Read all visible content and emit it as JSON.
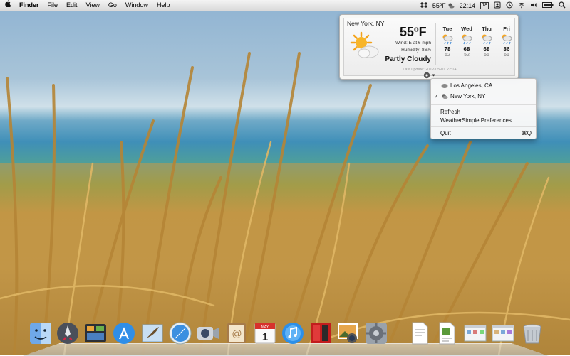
{
  "menubar": {
    "apple_icon": "apple-logo-icon",
    "app_name": "Finder",
    "menus": [
      "File",
      "Edit",
      "View",
      "Go",
      "Window",
      "Help"
    ],
    "weather_temp": "55ºF",
    "clock": "22:14",
    "calendar_day": "18"
  },
  "weather": {
    "city": "New York, NY",
    "temp": "55ºF",
    "wind": "Wind: E at 6 mph",
    "humidity": "Humidity: 86%",
    "condition": "Partly Cloudy",
    "last_update": "Last update: 2012-05-01  22:14",
    "forecast": [
      {
        "day": "Tue",
        "high": "78",
        "low": "52"
      },
      {
        "day": "Wed",
        "high": "68",
        "low": "52"
      },
      {
        "day": "Thu",
        "high": "68",
        "low": "55"
      },
      {
        "day": "Fri",
        "high": "86",
        "low": "61"
      }
    ]
  },
  "menu": {
    "locations": [
      {
        "label": "Los Angeles, CA",
        "checked": false
      },
      {
        "label": "New York, NY",
        "checked": true
      }
    ],
    "check_mark": "✓",
    "refresh": "Refresh",
    "preferences": "WeatherSimple Preferences...",
    "quit": "Quit",
    "quit_shortcut": "⌘Q"
  },
  "dock": {
    "items": [
      "finder-icon",
      "launchpad-icon",
      "mission-control-icon",
      "app-store-icon",
      "mail-icon",
      "safari-icon",
      "facetime-icon",
      "contacts-icon",
      "calendar-icon",
      "itunes-icon",
      "photo-booth-icon",
      "iphoto-icon",
      "system-preferences-icon",
      "document-icon",
      "preview-icon",
      "finder-window-icon",
      "finder-window-icon-2",
      "trash-icon"
    ],
    "calendar_month": "MAY",
    "calendar_day": "1"
  }
}
